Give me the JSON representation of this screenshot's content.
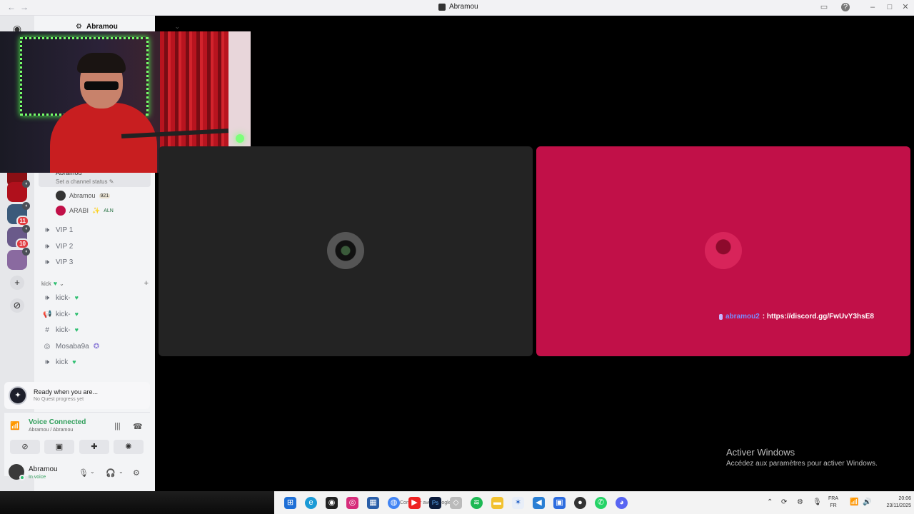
{
  "window": {
    "title": "Abramou",
    "back_icon": "←",
    "forward_icon": "→"
  },
  "guild": {
    "name": "Abramou",
    "current_channel": {
      "name": "Abramou",
      "status": "Set a channel status ✎"
    },
    "members_in_channel": [
      {
        "name": "Abramou",
        "tag": "921",
        "avatar_color": "#333333"
      },
      {
        "name": "ARABI",
        "tag": "ALN",
        "avatar_color": "#c11048"
      }
    ],
    "voice_channels": [
      {
        "name": "VIP 1"
      },
      {
        "name": "VIP 2"
      },
      {
        "name": "VIP 3"
      }
    ],
    "category": {
      "name": "kick"
    },
    "category_channels": [
      {
        "name": "kick-",
        "icon": "voice-icon"
      },
      {
        "name": "kick-",
        "icon": "speaker-icon"
      },
      {
        "name": "kick-",
        "icon": "hash-icon"
      },
      {
        "name": "Mosaba9a",
        "icon": "stage-icon"
      },
      {
        "name": "kick",
        "icon": "voice-icon"
      }
    ]
  },
  "servers": [
    {
      "color": "#8a0f14",
      "badge": ""
    },
    {
      "color": "#b0101c",
      "badge": ""
    },
    {
      "color": "#3b5a7a",
      "badge": "11"
    },
    {
      "color": "#6a5a8a",
      "badge": "10"
    },
    {
      "color": "#8a6aa0",
      "badge": ""
    }
  ],
  "quest": {
    "title": "Ready when you are...",
    "subtitle": "No Quest progress yet"
  },
  "voice": {
    "status": "Voice Connected",
    "location": "Abramou / Abramou"
  },
  "user": {
    "name": "Abramou",
    "status": "In voice"
  },
  "stage": {
    "caption_user": "abramou2",
    "caption_text": ": https://discord.gg/FwUvY3hsE8",
    "dark_tile_color": "#232323",
    "pink_tile_color": "#c11048"
  },
  "windows_activation": {
    "title": "Activer Windows",
    "subtitle": "Accédez aux paramètres pour activer Windows."
  },
  "taskbar": {
    "tooltip": "Continuer avec Google",
    "lang_top": "FRA",
    "lang_bottom": "FR",
    "time": "20:06",
    "date": "23/11/2025"
  },
  "colors": {
    "accent_green": "#2f9e5a",
    "brand_pink": "#c11048"
  }
}
